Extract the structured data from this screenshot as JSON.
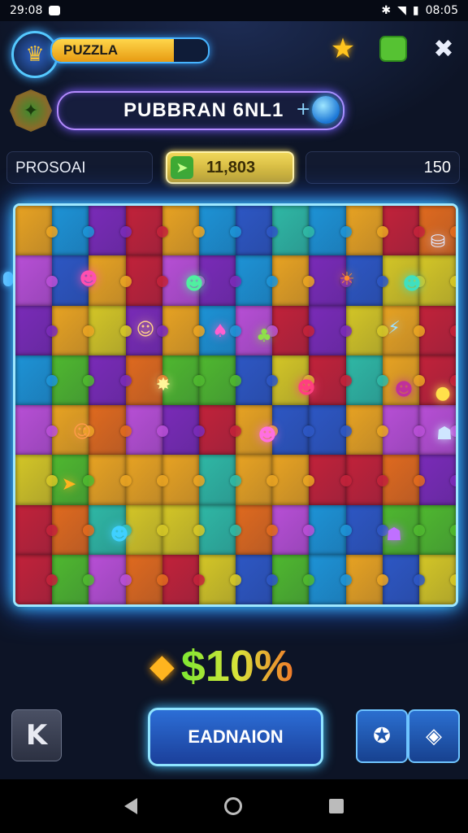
{
  "status_bar": {
    "time": "29:08",
    "right_time": "08:05"
  },
  "header": {
    "level_label": "PUZZLA",
    "level_progress": 0.78,
    "icons": [
      "avatar-icon",
      "star-icon",
      "chest-icon",
      "close-icon"
    ]
  },
  "title_bar": {
    "title": "PUBBRAN 6NL1",
    "plus": "+"
  },
  "stats": {
    "left_label": "PROSOAI",
    "mid_value": "11,803",
    "right_value": "150"
  },
  "score": {
    "value": "$10%"
  },
  "controls": {
    "back_label": "K",
    "main_label": "EADNAION"
  },
  "colors": {
    "tiles": [
      "#2d57c4",
      "#7a2bb8",
      "#c2223a",
      "#4fb82f",
      "#e8a322",
      "#1d93d6",
      "#b84fd6",
      "#e06a1e",
      "#2fb8a5",
      "#d4c626"
    ],
    "accent": "#3fd1ff"
  }
}
